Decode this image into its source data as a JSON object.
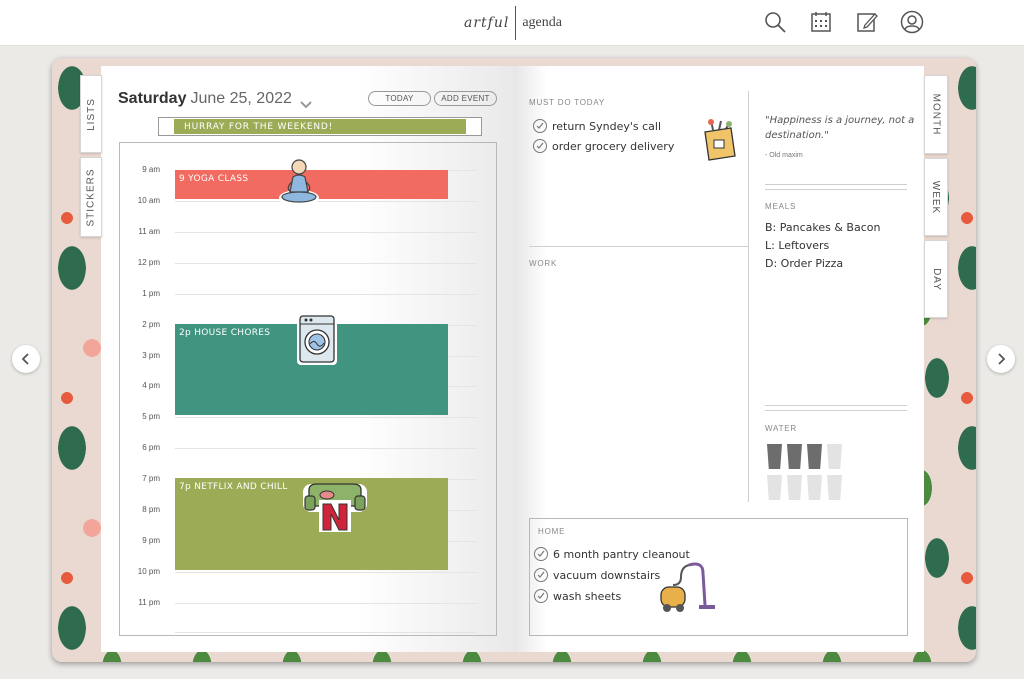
{
  "header": {
    "logo_left": "artful",
    "logo_right": "agenda",
    "icons": [
      "search-icon",
      "calendar-icon",
      "edit-icon",
      "account-icon"
    ]
  },
  "colors": {
    "yoga": "#f26b60",
    "chores": "#409480",
    "netflix": "#9bab56",
    "banner": "#9bab56"
  },
  "left_tabs": [
    "LISTS",
    "STICKERS"
  ],
  "right_tabs": [
    "MONTH",
    "WEEK",
    "DAY"
  ],
  "day": {
    "weekday": "Saturday",
    "date": "June 25, 2022",
    "today_button": "TODAY",
    "add_event_button": "ADD EVENT",
    "banner": "HURRAY FOR THE WEEKEND!"
  },
  "schedule": {
    "hours": [
      "9 am",
      "10 am",
      "11 am",
      "12 pm",
      "1 pm",
      "2 pm",
      "3 pm",
      "4 pm",
      "5 pm",
      "6 pm",
      "7 pm",
      "8 pm",
      "9 pm",
      "10 pm",
      "11 pm"
    ],
    "events": [
      {
        "label": "9 YOGA CLASS"
      },
      {
        "label": "2p HOUSE CHORES"
      },
      {
        "label": "7p NETFLIX AND CHILL"
      }
    ]
  },
  "must_do": {
    "label": "MUST DO TODAY",
    "items": [
      "return Syndey's call",
      "order grocery delivery"
    ]
  },
  "work": {
    "label": "WORK"
  },
  "quote": {
    "text": "\"Happiness is a journey, not a destination.\"",
    "author": "- Old maxim"
  },
  "meals": {
    "label": "MEALS",
    "items": [
      "B: Pancakes & Bacon",
      "L: Leftovers",
      "D: Order Pizza"
    ]
  },
  "water": {
    "label": "WATER",
    "glasses_total": 8,
    "glasses_filled": 3
  },
  "home": {
    "label": "HOME",
    "items": [
      "6 month pantry cleanout",
      "vacuum downstairs",
      "wash sheets"
    ]
  }
}
